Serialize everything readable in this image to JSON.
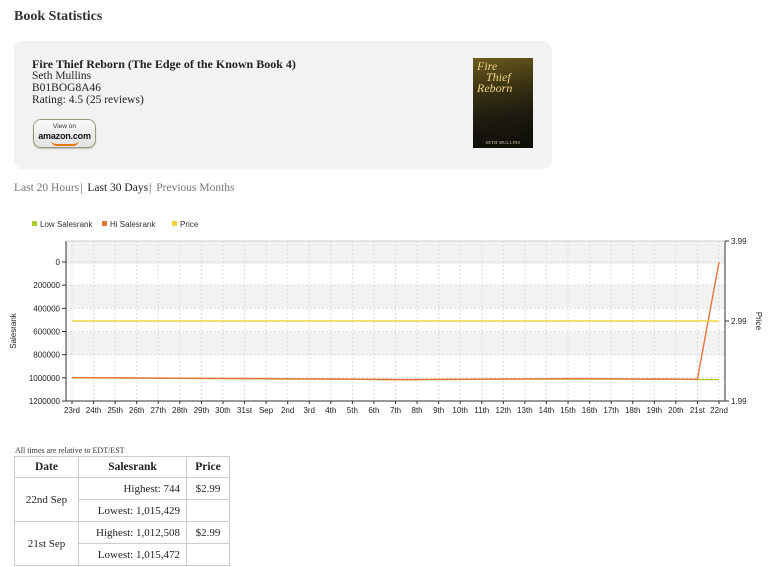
{
  "page": {
    "title": "Book Statistics"
  },
  "book": {
    "title": "Fire Thief Reborn (The Edge of the Known Book 4)",
    "author": "Seth Mullins",
    "asin": "B01BOG8A46",
    "rating": "Rating: 4.5  (25 reviews)",
    "amazon_button": {
      "top": "View on",
      "logo": "amazon.com"
    },
    "cover": {
      "title_lines": [
        "Fire",
        "Thief",
        "Reborn"
      ],
      "author": "SETH MULLINS"
    }
  },
  "range_links": [
    {
      "label": "Last 20 Hours",
      "active": false
    },
    {
      "label": "Last 30 Days",
      "active": true
    },
    {
      "label": "Previous Months",
      "active": false
    }
  ],
  "chart_data": {
    "type": "line",
    "legend": [
      {
        "label": "Low Salesrank",
        "color": "#a8cc33"
      },
      {
        "label": "Hi Salesrank",
        "color": "#e8743b"
      },
      {
        "label": "Price",
        "color": "#f0d640"
      }
    ],
    "legend_position": "top-left",
    "grid": true,
    "x": [
      "23rd",
      "24th",
      "25th",
      "26th",
      "27th",
      "28th",
      "29th",
      "30th",
      "31st",
      "Sep",
      "2nd",
      "3rd",
      "4th",
      "5th",
      "6th",
      "7th",
      "8th",
      "9th",
      "10th",
      "11th",
      "12th",
      "13th",
      "14th",
      "15th",
      "16th",
      "17th",
      "18th",
      "19th",
      "20th",
      "21st",
      "22nd"
    ],
    "y_left": {
      "label": "Salesrank",
      "reversed": true,
      "range": [
        0,
        1200000
      ],
      "ticks": [
        "0",
        "200000",
        "400000",
        "600000",
        "800000",
        "1000000",
        "1200000"
      ]
    },
    "y_right": {
      "label": "Price",
      "range": [
        1.99,
        3.99
      ],
      "ticks": [
        "3.99",
        "2.99",
        "1.99"
      ]
    },
    "series": [
      {
        "name": "Low Salesrank",
        "color": "#a8cc33",
        "axis": "left",
        "values": [
          1000000,
          1001000,
          1002000,
          1003000,
          1004000,
          1005000,
          1006000,
          1007000,
          1008000,
          1009000,
          1010000,
          1011000,
          1012000,
          1013000,
          1015000,
          1016000,
          1016000,
          1015000,
          1014000,
          1013000,
          1012000,
          1011000,
          1010000,
          1010000,
          1010000,
          1011000,
          1012000,
          1013000,
          1013000,
          1015429,
          1015429
        ]
      },
      {
        "name": "Hi Salesrank",
        "color": "#e8743b",
        "axis": "left",
        "values": [
          998000,
          999000,
          1000000,
          1001000,
          1002000,
          1003000,
          1004000,
          1005000,
          1006000,
          1007000,
          1008000,
          1009000,
          1010000,
          1011000,
          1013000,
          1014000,
          1014000,
          1013000,
          1012000,
          1011000,
          1010000,
          1009000,
          1008000,
          1007000,
          1007000,
          1008000,
          1009000,
          1010000,
          1011000,
          1012508,
          744
        ]
      },
      {
        "name": "Price",
        "color": "#f0d640",
        "axis": "right",
        "values": [
          2.99,
          2.99,
          2.99,
          2.99,
          2.99,
          2.99,
          2.99,
          2.99,
          2.99,
          2.99,
          2.99,
          2.99,
          2.99,
          2.99,
          2.99,
          2.99,
          2.99,
          2.99,
          2.99,
          2.99,
          2.99,
          2.99,
          2.99,
          2.99,
          2.99,
          2.99,
          2.99,
          2.99,
          2.99,
          2.99,
          2.99
        ]
      }
    ]
  },
  "timezone_note": "All times are relative to EDT/EST",
  "table": {
    "headers": [
      "Date",
      "Salesrank",
      "Price"
    ],
    "rows": [
      {
        "date": "22nd Sep",
        "highest": "Highest: 744",
        "lowest": "Lowest: 1,015,429",
        "price": "$2.99"
      },
      {
        "date": "21st Sep",
        "highest": "Highest: 1,012,508",
        "lowest": "Lowest: 1,015,472",
        "price": "$2.99"
      }
    ]
  }
}
